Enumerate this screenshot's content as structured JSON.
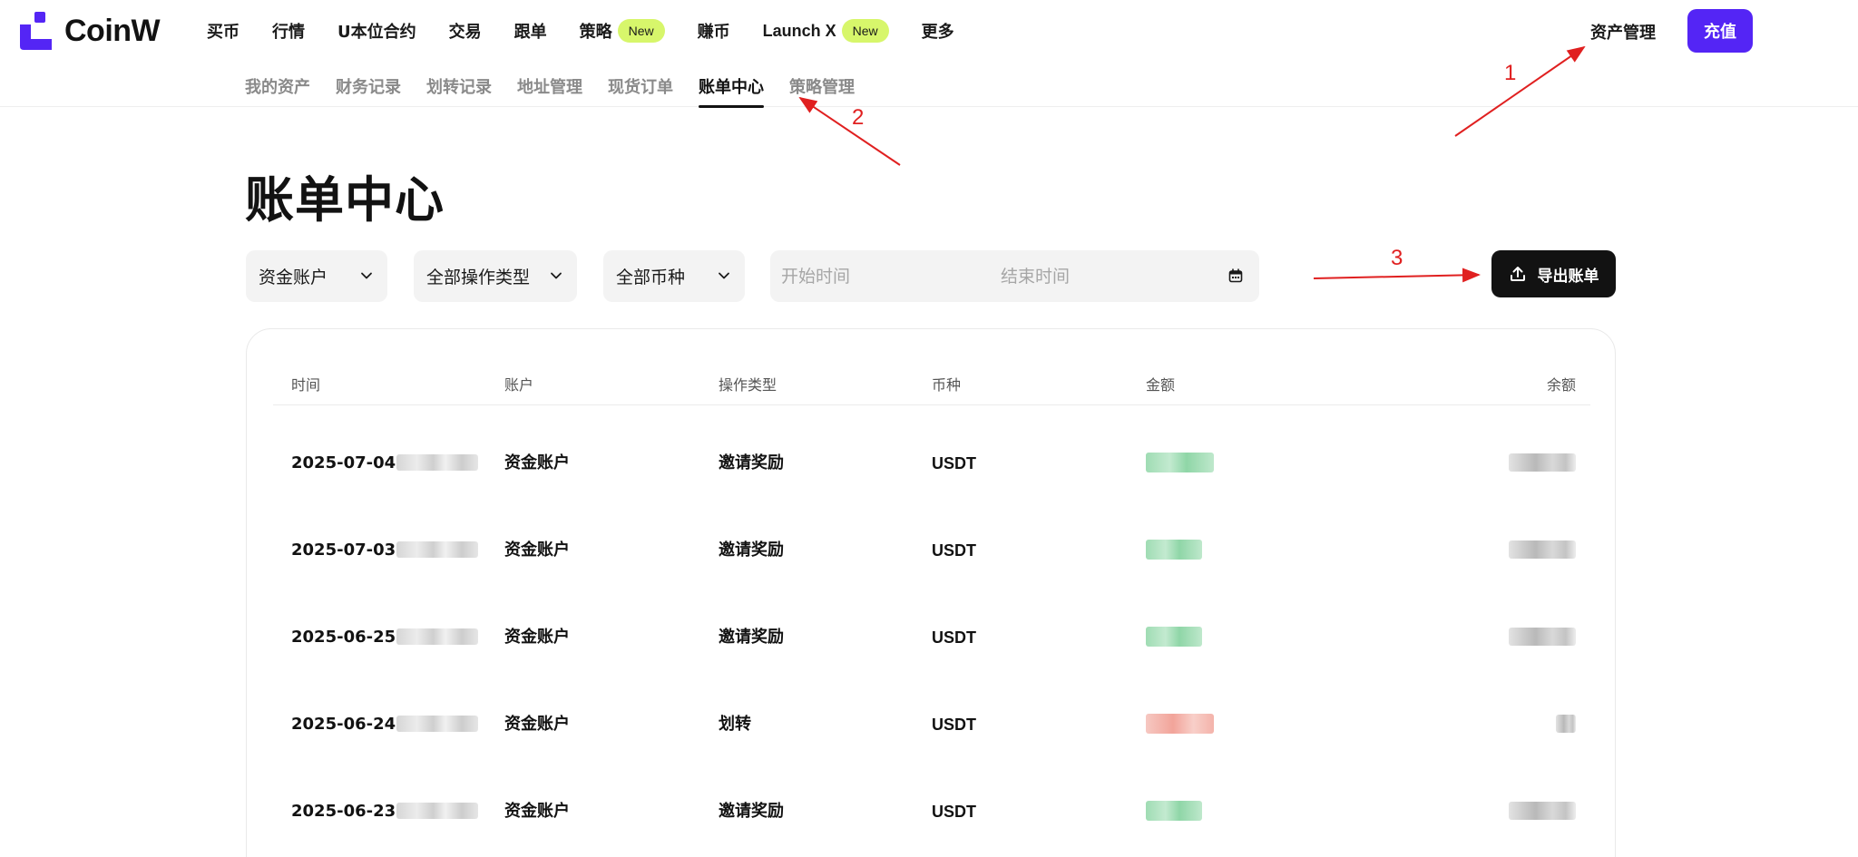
{
  "brand": {
    "name": "CoinW",
    "color": "#5425f5"
  },
  "topnav": {
    "items": [
      {
        "label": "买币"
      },
      {
        "label": "行情"
      },
      {
        "label": "U本位合约"
      },
      {
        "label": "交易"
      },
      {
        "label": "跟单"
      },
      {
        "label": "策略",
        "badge": "New"
      },
      {
        "label": "赚币"
      },
      {
        "label": "Launch X",
        "badge": "New"
      },
      {
        "label": "更多"
      }
    ],
    "asset_management": "资产管理",
    "deposit": "充值"
  },
  "subnav": {
    "tabs": [
      {
        "label": "我的资产"
      },
      {
        "label": "财务记录"
      },
      {
        "label": "划转记录"
      },
      {
        "label": "地址管理"
      },
      {
        "label": "现货订单"
      },
      {
        "label": "账单中心",
        "active": true
      },
      {
        "label": "策略管理"
      }
    ]
  },
  "page_title": "账单中心",
  "filters": {
    "account": "资金账户",
    "operation_type": "全部操作类型",
    "currency": "全部币种",
    "start_placeholder": "开始时间",
    "end_placeholder": "结束时间",
    "export": "导出账单"
  },
  "table": {
    "headers": [
      "时间",
      "账户",
      "操作类型",
      "币种",
      "金额",
      "余额"
    ],
    "rows": [
      {
        "date": "2025-07-04",
        "account": "资金账户",
        "type": "邀请奖励",
        "coin": "USDT",
        "direction": "in"
      },
      {
        "date": "2025-07-03",
        "account": "资金账户",
        "type": "邀请奖励",
        "coin": "USDT",
        "direction": "in"
      },
      {
        "date": "2025-06-25",
        "account": "资金账户",
        "type": "邀请奖励",
        "coin": "USDT",
        "direction": "in"
      },
      {
        "date": "2025-06-24",
        "account": "资金账户",
        "type": "划转",
        "coin": "USDT",
        "direction": "out"
      },
      {
        "date": "2025-06-23",
        "account": "资金账户",
        "type": "邀请奖励",
        "coin": "USDT",
        "direction": "in"
      }
    ]
  },
  "annotations": {
    "labels": [
      "1",
      "2",
      "3"
    ],
    "color": "#e02020"
  }
}
